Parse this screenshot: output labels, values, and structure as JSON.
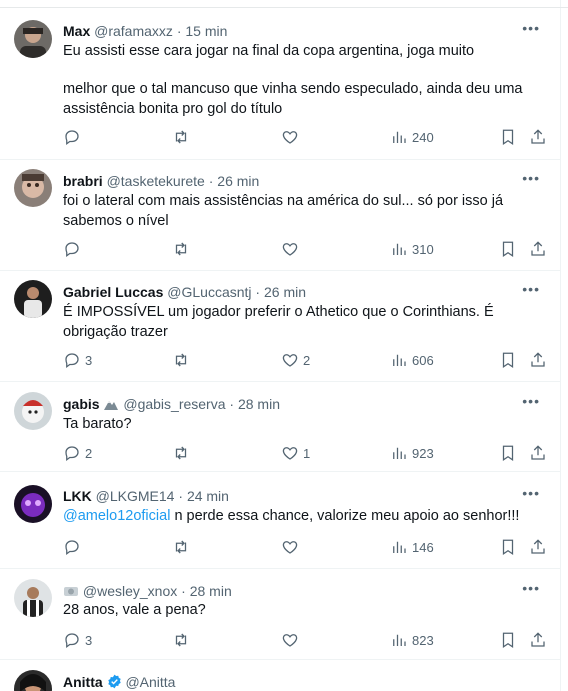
{
  "tweets": [
    {
      "name": "Max",
      "handle": "@rafamaxxz",
      "time": "15 min",
      "text1": "Eu assisti esse cara jogar na final da copa argentina, joga muito",
      "text2": "melhor que o tal mancuso que vinha sendo especulado, ainda deu uma assistência bonita pro gol do título",
      "replies": "",
      "retweets": "",
      "likes": "",
      "views": "240"
    },
    {
      "name": "brabri",
      "handle": "@tasketekurete",
      "time": "26 min",
      "text1": "foi o lateral com mais assistências na américa do sul... só por isso já sabemos o nível",
      "replies": "",
      "retweets": "",
      "likes": "",
      "views": "310"
    },
    {
      "name": "Gabriel Luccas",
      "handle": "@GLuccasntj",
      "time": "26 min",
      "text1": "É IMPOSSÍVEL um jogador preferir o Athetico que o Corinthians. É obrigação trazer",
      "replies": "3",
      "retweets": "",
      "likes": "2",
      "views": "606"
    },
    {
      "name": "gabis",
      "handle": "@gabis_reserva",
      "time": "28 min",
      "text1": "Ta barato?",
      "replies": "2",
      "retweets": "",
      "likes": "1",
      "views": "923"
    },
    {
      "name": "LKK",
      "handle": "@LKGME14",
      "time": "24 min",
      "mention": "@amelo12oficial",
      "text1": " n perde essa chance, valorize meu apoio ao senhor!!!",
      "replies": "",
      "retweets": "",
      "likes": "",
      "views": "146"
    },
    {
      "name": "",
      "handle": "@wesley_xnox",
      "time": "28 min",
      "text1": "28 anos, vale a pena?",
      "replies": "3",
      "retweets": "",
      "likes": "",
      "views": "823"
    },
    {
      "name": "Anitta",
      "handle": "@Anitta",
      "time": ""
    }
  ],
  "separator": "·",
  "more_label": "•••",
  "icons": {
    "reply": "reply-icon",
    "retweet": "retweet-icon",
    "like": "heart-icon",
    "views": "views-icon",
    "bookmark": "bookmark-icon",
    "share": "share-icon",
    "verified": "verified-badge-icon"
  },
  "colors": {
    "text": "#0f1419",
    "secondary": "#536471",
    "link": "#1d9bf0",
    "border": "#eff3f4"
  }
}
